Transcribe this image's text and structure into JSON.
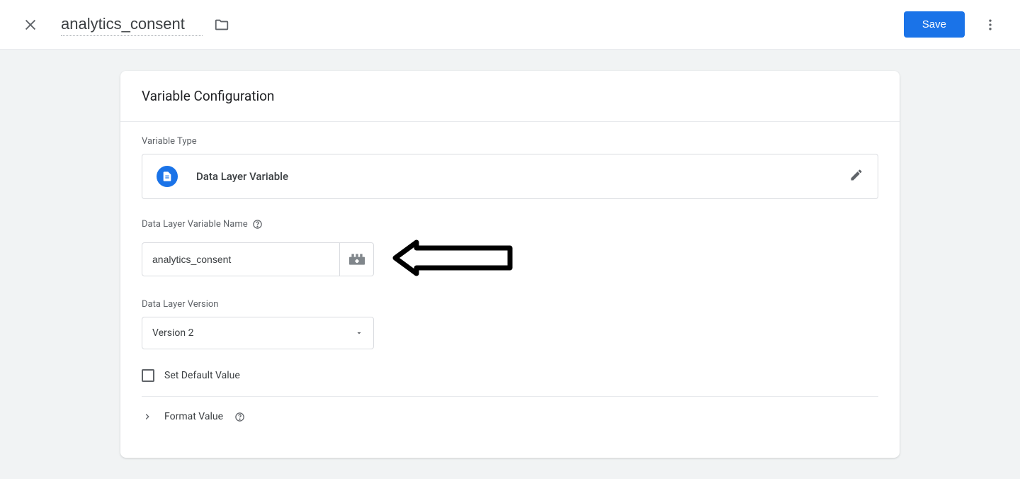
{
  "header": {
    "variable_name": "analytics_consent",
    "save_label": "Save"
  },
  "card": {
    "title": "Variable Configuration",
    "type_label": "Variable Type",
    "type_name": "Data Layer Variable",
    "dlv_name_label": "Data Layer Variable Name",
    "dlv_name_value": "analytics_consent",
    "version_label": "Data Layer Version",
    "version_value": "Version 2",
    "set_default_label": "Set Default Value",
    "format_value_label": "Format Value"
  }
}
